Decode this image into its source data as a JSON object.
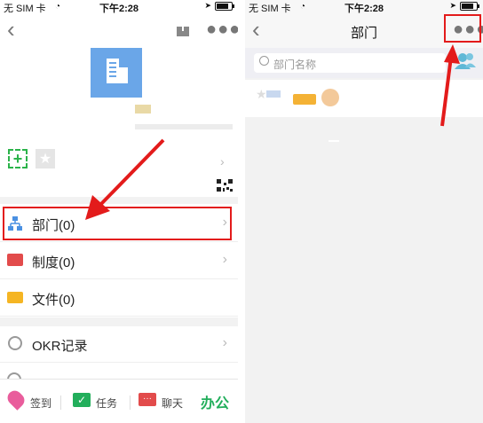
{
  "left": {
    "status": {
      "carrier": "无 SIM 卡",
      "time": "下午2:28"
    },
    "menu": [
      {
        "label": "部门(0)"
      },
      {
        "label": "制度(0)"
      },
      {
        "label": "文件(0)"
      },
      {
        "label": "OKR记录"
      }
    ],
    "tabs": [
      {
        "label": "签到"
      },
      {
        "label": "任务"
      },
      {
        "label": "聊天"
      },
      {
        "label": "办公"
      }
    ]
  },
  "right": {
    "status": {
      "carrier": "无 SIM 卡",
      "time": "下午2:28"
    },
    "title": "部门",
    "search_placeholder": "部门名称"
  },
  "colors": {
    "highlight": "#e31b1b",
    "accent_green": "#22ae5b",
    "blue": "#4a90e2"
  }
}
